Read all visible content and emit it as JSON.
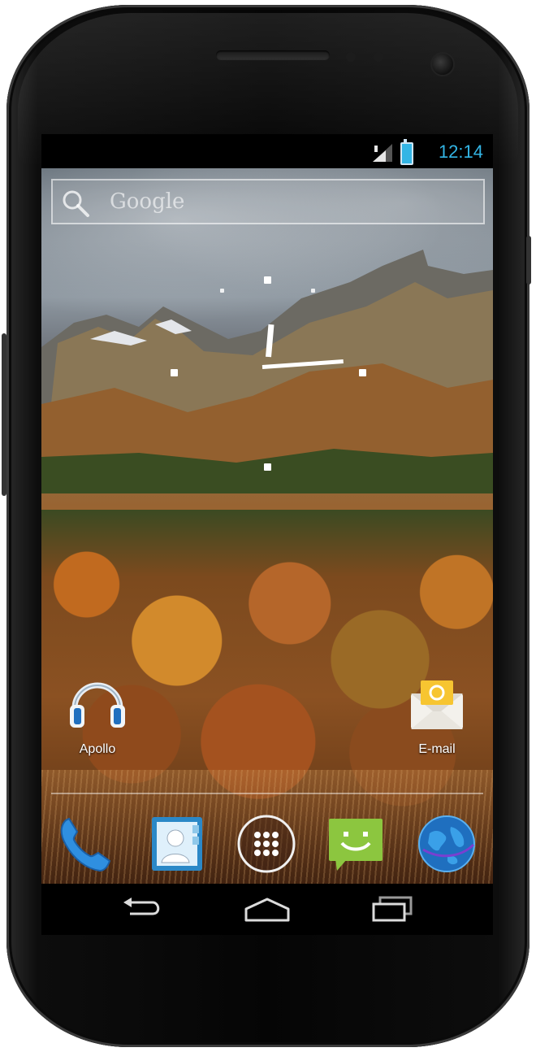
{
  "status_bar": {
    "time": "12:14"
  },
  "search": {
    "label": "Google"
  },
  "shortcuts": [
    {
      "label": "Apollo"
    },
    {
      "label": "E-mail"
    }
  ],
  "colors": {
    "accent": "#33b5e5",
    "screen_bg": "#000000"
  },
  "icons": {
    "dock": [
      "phone-icon",
      "contacts-icon",
      "app-drawer-icon",
      "messaging-icon",
      "browser-icon"
    ],
    "nav": [
      "back-icon",
      "home-icon",
      "recent-apps-icon"
    ]
  }
}
